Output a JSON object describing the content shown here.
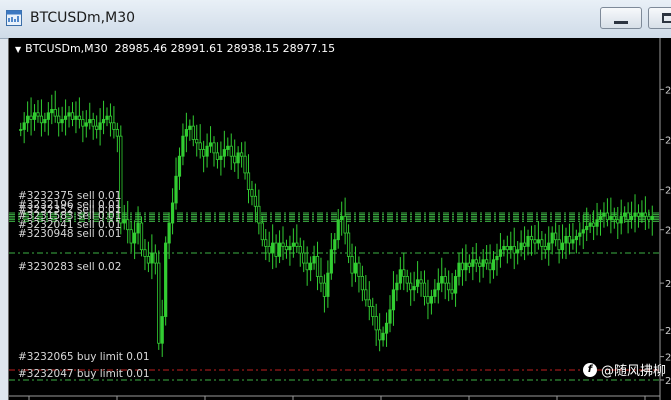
{
  "window": {
    "title": "BTCUSDm,M30",
    "icons": {
      "app": "mt-chart-window-icon",
      "minimize": "minimize-icon",
      "maximize": "maximize-icon"
    }
  },
  "chart_header": {
    "symbol": "BTCUSDm,M30",
    "ohlc": "28985.46 28991.61 28938.15 28977.15"
  },
  "order_labels": [
    "#3232375 sell 0.01",
    "#3232196 sell 0.01",
    "#3232352 sell 0.01",
    "#3231583 sell 0.01",
    "#3232041 sell 0.01",
    "#3230948 sell 0.01",
    "#3230283 sell 0.02",
    "#3232065 buy limit 0.01",
    "#3232047 buy limit 0.01"
  ],
  "right_axis_ticks": [
    "2",
    "2",
    "2",
    "2",
    "2",
    "2",
    "2",
    "2"
  ],
  "colors": {
    "candle": "#32cd32",
    "order_line": "#3cb043",
    "pending_line": "#c02020",
    "background": "#000000"
  },
  "watermark": {
    "text": "@随风拂柳"
  },
  "chart_data": {
    "type": "candlestick",
    "symbol": "BTCUSDm",
    "timeframe": "M30",
    "last_ohlc": {
      "open": 28985.46,
      "high": 28991.61,
      "low": 28938.15,
      "close": 28977.15
    },
    "close_series": [
      0.22,
      0.2,
      0.18,
      0.19,
      0.17,
      0.18,
      0.2,
      0.19,
      0.17,
      0.16,
      0.18,
      0.2,
      0.19,
      0.18,
      0.17,
      0.19,
      0.18,
      0.19,
      0.21,
      0.2,
      0.19,
      0.21,
      0.22,
      0.2,
      0.19,
      0.18,
      0.2,
      0.22,
      0.24,
      0.5,
      0.49,
      0.52,
      0.56,
      0.53,
      0.5,
      0.58,
      0.6,
      0.62,
      0.59,
      0.62,
      0.86,
      0.78,
      0.56,
      0.5,
      0.44,
      0.36,
      0.3,
      0.24,
      0.22,
      0.21,
      0.25,
      0.26,
      0.28,
      0.3,
      0.27,
      0.26,
      0.29,
      0.31,
      0.3,
      0.28,
      0.27,
      0.3,
      0.32,
      0.29,
      0.3,
      0.35,
      0.4,
      0.42,
      0.45,
      0.5,
      0.55,
      0.57,
      0.59,
      0.56,
      0.6,
      0.56,
      0.57,
      0.58,
      0.57,
      0.56,
      0.57,
      0.59,
      0.62,
      0.64,
      0.62,
      0.6,
      0.66,
      0.68,
      0.72,
      0.65,
      0.58,
      0.55,
      0.49,
      0.48,
      0.53,
      0.6,
      0.65,
      0.62,
      0.66,
      0.7,
      0.73,
      0.75,
      0.78,
      0.82,
      0.85,
      0.83,
      0.8,
      0.76,
      0.7,
      0.68,
      0.64,
      0.66,
      0.68,
      0.7,
      0.69,
      0.67,
      0.68,
      0.72,
      0.74,
      0.72,
      0.7,
      0.68,
      0.66,
      0.68,
      0.7,
      0.71,
      0.66,
      0.62,
      0.64,
      0.62,
      0.63,
      0.61,
      0.62,
      0.63,
      0.61,
      0.62,
      0.64,
      0.61,
      0.6,
      0.58,
      0.57,
      0.58,
      0.57,
      0.59,
      0.58,
      0.56,
      0.57,
      0.54,
      0.55,
      0.56,
      0.55,
      0.57,
      0.58,
      0.56,
      0.53,
      0.55,
      0.58,
      0.56,
      0.54,
      0.56,
      0.55,
      0.54,
      0.53,
      0.52,
      0.51,
      0.5,
      0.51,
      0.49,
      0.48,
      0.47,
      0.49,
      0.48,
      0.49,
      0.5,
      0.48,
      0.47,
      0.49,
      0.48,
      0.47,
      0.48,
      0.47,
      0.48,
      0.49,
      0.48
    ],
    "order_levels": [
      0.47,
      0.475,
      0.48,
      0.485,
      0.49,
      0.495,
      0.59,
      0.94,
      0.97
    ],
    "y_range": [
      0,
      1
    ]
  }
}
